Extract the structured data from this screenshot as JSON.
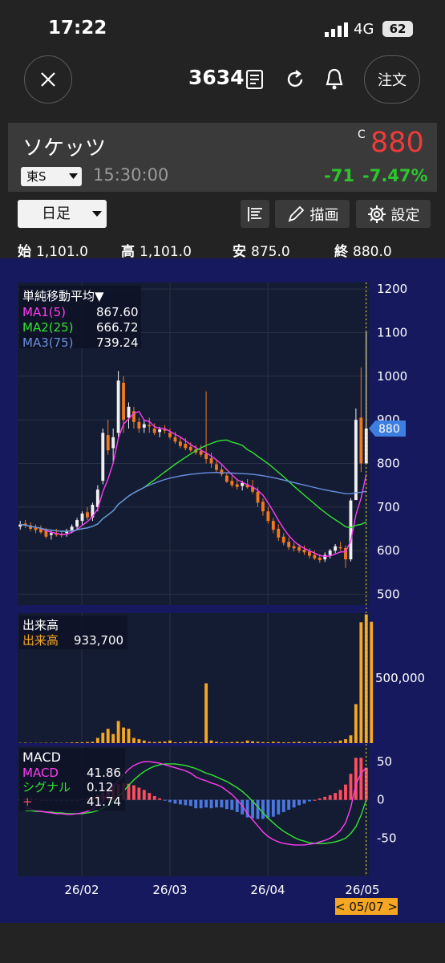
{
  "status_bar": {
    "time": "17:22",
    "network": "4G",
    "battery": "62"
  },
  "header": {
    "stock_code": "3634",
    "order_label": "注文",
    "icons": [
      "close-icon",
      "document-icon",
      "refresh-icon",
      "bell-icon"
    ]
  },
  "quote": {
    "name": "ソケッツ",
    "exchange": "東S",
    "time": "15:30:00",
    "price_marker": "C",
    "price": "880",
    "change": "-71",
    "change_pct": "-7.47%",
    "colors": {
      "price": "#f03a3a",
      "change": "#2dc52d"
    }
  },
  "toolbar": {
    "period": "日足",
    "draw_label": "描画",
    "settings_label": "設定"
  },
  "ohlc": {
    "open_label": "始",
    "open": "1,101.0",
    "high_label": "高",
    "high": "1,101.0",
    "low_label": "安",
    "low": "875.0",
    "close_label": "終",
    "close": "880.0"
  },
  "chart_data": {
    "type": "candlestick",
    "x_labels": [
      "26/02",
      "26/03",
      "26/04",
      "26/05"
    ],
    "selected_date": "< 05/07 >",
    "price_panel": {
      "legend_title": "単純移動平均▼",
      "legend": [
        {
          "name": "MA1(5)",
          "value": "867.60",
          "color": "#ff3cf0"
        },
        {
          "name": "MA2(25)",
          "value": "666.72",
          "color": "#33e433"
        },
        {
          "name": "MA3(75)",
          "value": "739.24",
          "color": "#6a8fe0"
        }
      ],
      "y_ticks": [
        "1200",
        "1100",
        "1000",
        "900",
        "800",
        "700",
        "600",
        "500"
      ],
      "ylim": [
        475,
        1215
      ],
      "last_price_tag": "880",
      "candles": [
        [
          655,
          668,
          648,
          660
        ],
        [
          662,
          670,
          652,
          657
        ],
        [
          658,
          665,
          645,
          650
        ],
        [
          652,
          660,
          640,
          647
        ],
        [
          650,
          658,
          638,
          642
        ],
        [
          645,
          652,
          628,
          632
        ],
        [
          636,
          645,
          625,
          640
        ],
        [
          640,
          650,
          632,
          636
        ],
        [
          638,
          646,
          630,
          635
        ],
        [
          640,
          650,
          632,
          645
        ],
        [
          646,
          660,
          640,
          655
        ],
        [
          655,
          675,
          648,
          670
        ],
        [
          668,
          690,
          660,
          685
        ],
        [
          688,
          700,
          670,
          676
        ],
        [
          676,
          710,
          668,
          705
        ],
        [
          700,
          750,
          690,
          740
        ],
        [
          760,
          880,
          752,
          870
        ],
        [
          865,
          900,
          820,
          830
        ],
        [
          835,
          880,
          800,
          860
        ],
        [
          870,
          1012,
          860,
          990
        ],
        [
          985,
          1000,
          870,
          900
        ],
        [
          905,
          940,
          880,
          930
        ],
        [
          920,
          930,
          880,
          895
        ],
        [
          895,
          905,
          870,
          880
        ],
        [
          882,
          900,
          870,
          890
        ],
        [
          888,
          905,
          870,
          885
        ],
        [
          880,
          892,
          865,
          870
        ],
        [
          872,
          884,
          860,
          878
        ],
        [
          878,
          888,
          868,
          875
        ],
        [
          870,
          880,
          855,
          860
        ],
        [
          860,
          872,
          845,
          850
        ],
        [
          850,
          860,
          835,
          840
        ],
        [
          845,
          858,
          830,
          835
        ],
        [
          838,
          848,
          826,
          830
        ],
        [
          832,
          842,
          820,
          825
        ],
        [
          828,
          842,
          815,
          820
        ],
        [
          822,
          965,
          800,
          810
        ],
        [
          812,
          825,
          790,
          800
        ],
        [
          798,
          808,
          778,
          785
        ],
        [
          786,
          795,
          770,
          775
        ],
        [
          772,
          780,
          755,
          758
        ],
        [
          760,
          770,
          745,
          750
        ],
        [
          752,
          762,
          740,
          746
        ],
        [
          748,
          760,
          738,
          755
        ],
        [
          752,
          764,
          742,
          745
        ],
        [
          746,
          762,
          730,
          735
        ],
        [
          735,
          745,
          700,
          710
        ],
        [
          712,
          720,
          680,
          690
        ],
        [
          690,
          700,
          662,
          668
        ],
        [
          668,
          675,
          640,
          648
        ],
        [
          650,
          660,
          622,
          630
        ],
        [
          632,
          640,
          612,
          618
        ],
        [
          620,
          630,
          602,
          608
        ],
        [
          610,
          618,
          598,
          605
        ],
        [
          608,
          615,
          595,
          600
        ],
        [
          602,
          612,
          590,
          596
        ],
        [
          598,
          605,
          582,
          588
        ],
        [
          590,
          600,
          578,
          582
        ],
        [
          584,
          592,
          572,
          578
        ],
        [
          580,
          596,
          574,
          590
        ],
        [
          590,
          604,
          582,
          600
        ],
        [
          600,
          615,
          594,
          610
        ],
        [
          608,
          620,
          600,
          606
        ],
        [
          606,
          612,
          560,
          580
        ],
        [
          580,
          720,
          575,
          715
        ],
        [
          716,
          926,
          800,
          900
        ],
        [
          905,
          1020,
          780,
          800
        ],
        [
          800,
          1101,
          875,
          880
        ]
      ]
    },
    "volume_panel": {
      "legend_title": "出来高",
      "series_name": "出来高",
      "value": "933,700",
      "y_ticks": [
        "500,000"
      ],
      "ymax": 1000000,
      "values": [
        2000,
        3000,
        2000,
        1500,
        2000,
        2500,
        2000,
        3000,
        2000,
        3000,
        5000,
        6000,
        6000,
        8000,
        10000,
        40000,
        80000,
        110000,
        70000,
        170000,
        120000,
        110000,
        40000,
        30000,
        20000,
        10000,
        8000,
        10000,
        12000,
        20000,
        6000,
        6000,
        8000,
        14000,
        10000,
        6000,
        460000,
        20000,
        10000,
        6000,
        6000,
        8000,
        10000,
        8000,
        20000,
        14000,
        10000,
        8000,
        6000,
        10000,
        8000,
        6000,
        6000,
        8000,
        10000,
        6000,
        6000,
        10000,
        6000,
        6000,
        8000,
        10000,
        20000,
        30000,
        60000,
        300000,
        930000,
        990000,
        933700
      ]
    },
    "macd_panel": {
      "legend_title": "MACD",
      "legend": [
        {
          "name": "MACD",
          "value": "41.86",
          "color": "#ff3cf0"
        },
        {
          "name": "シグナル",
          "value": "0.12",
          "color": "#33e433"
        },
        {
          "name": "+",
          "value": "41.74",
          "color": "#ff4d5e"
        }
      ],
      "y_ticks": [
        "50",
        "0",
        "-50"
      ],
      "ylim": [
        -100,
        70
      ],
      "macd": [
        -10,
        -12,
        -14,
        -15,
        -16,
        -17,
        -18,
        -18,
        -19,
        -19,
        -18,
        -17,
        -15,
        -12,
        -8,
        -2,
        8,
        18,
        25,
        33,
        40,
        45,
        48,
        50,
        50,
        49,
        48,
        46,
        44,
        42,
        40,
        38,
        35,
        30,
        27,
        25,
        22,
        20,
        17,
        12,
        7,
        0,
        -8,
        -18,
        -26,
        -34,
        -42,
        -48,
        -52,
        -55,
        -57,
        -58,
        -59,
        -59,
        -59,
        -58,
        -57,
        -55,
        -53,
        -50,
        -46,
        -40,
        -30,
        -10,
        20,
        35,
        42
      ],
      "signal": [
        -14,
        -14,
        -15,
        -15,
        -16,
        -16,
        -17,
        -17,
        -18,
        -18,
        -18,
        -18,
        -17,
        -16,
        -14,
        -11,
        -7,
        -2,
        4,
        11,
        19,
        26,
        32,
        37,
        41,
        44,
        46,
        47,
        47,
        47,
        46,
        45,
        43,
        41,
        38,
        35,
        33,
        30,
        27,
        24,
        20,
        16,
        11,
        5,
        -2,
        -9,
        -17,
        -24,
        -30,
        -36,
        -41,
        -45,
        -49,
        -52,
        -54,
        -56,
        -57,
        -57,
        -57,
        -56,
        -55,
        -53,
        -50,
        -44,
        -35,
        -20,
        0
      ],
      "histogram": [
        2,
        2,
        1,
        0,
        0,
        -1,
        -1,
        -1,
        -1,
        -1,
        0,
        1,
        2,
        4,
        6,
        9,
        15,
        20,
        21,
        22,
        21,
        19,
        16,
        13,
        9,
        5,
        2,
        -1,
        -3,
        -5,
        -6,
        -7,
        -8,
        -11,
        -11,
        -10,
        -11,
        -10,
        -10,
        -12,
        -13,
        -16,
        -19,
        -23,
        -24,
        -25,
        -25,
        -24,
        -22,
        -19,
        -16,
        -13,
        -10,
        -7,
        -5,
        -2,
        0,
        2,
        4,
        6,
        9,
        13,
        20,
        34,
        55,
        55,
        42
      ]
    }
  }
}
